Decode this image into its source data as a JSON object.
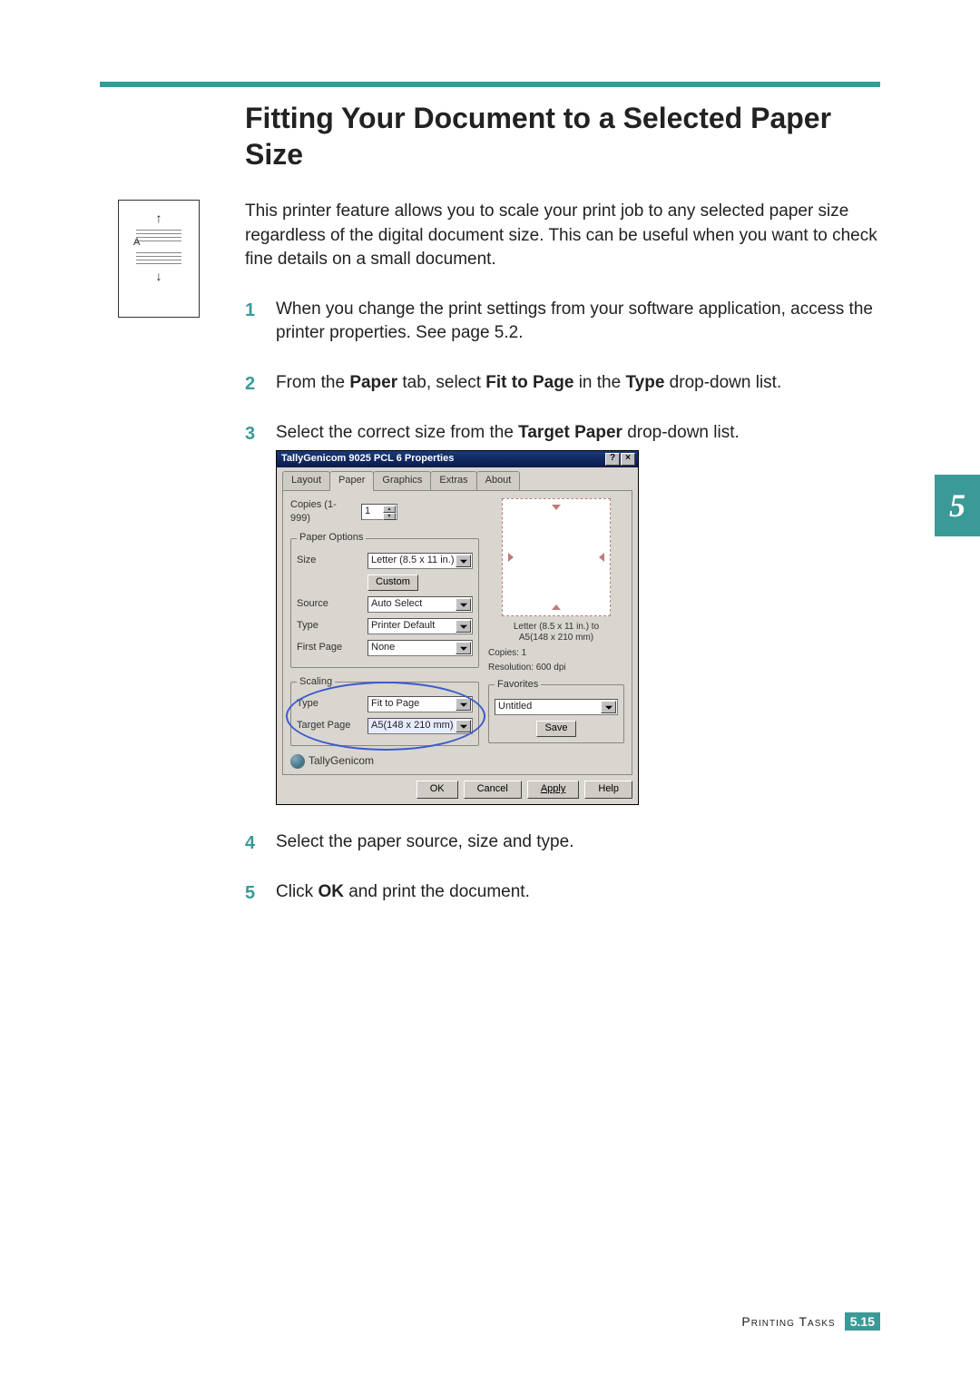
{
  "page": {
    "title": "Fitting Your Document to a Selected Paper Size",
    "intro": "This printer feature allows you to scale your print job to any selected paper size regardless of the digital document size. This can be useful when you want to check fine details on a small document.",
    "chapter_number": "5",
    "footer_label": "Printing Tasks",
    "footer_chapter": "5.",
    "footer_page": "15",
    "diagram_letter": "A"
  },
  "steps": {
    "s1": "When you change the print settings from your software application, access the printer properties. See page 5.2.",
    "s2_a": "From the ",
    "s2_b": "Paper",
    "s2_c": " tab, select ",
    "s2_d": "Fit to Page",
    "s2_e": " in the ",
    "s2_f": "Type",
    "s2_g": " drop-down list.",
    "s3_a": "Select the correct size from the ",
    "s3_b": "Target Paper",
    "s3_c": " drop-down list.",
    "s4": "Select the paper source, size and type.",
    "s5_a": "Click ",
    "s5_b": "OK",
    "s5_c": " and print the document."
  },
  "dialog": {
    "title": "TallyGenicom 9025 PCL 6 Properties",
    "help_btn": "?",
    "close_btn": "×",
    "tabs": {
      "t0": "Layout",
      "t1": "Paper",
      "t2": "Graphics",
      "t3": "Extras",
      "t4": "About"
    },
    "copies_label": "Copies (1-999)",
    "copies_value": "1",
    "paper_options_legend": "Paper Options",
    "size_label": "Size",
    "size_value": "Letter (8.5 x 11 in.)",
    "custom_btn": "Custom",
    "source_label": "Source",
    "source_value": "Auto Select",
    "type_label": "Type",
    "type_value": "Printer Default",
    "firstpage_label": "First Page",
    "firstpage_value": "None",
    "scaling_legend": "Scaling",
    "scaling_type_label": "Type",
    "scaling_type_value": "Fit to Page",
    "target_page_label": "Target Page",
    "target_page_value": "A5(148 x 210 mm)",
    "preview_line1": "Letter (8.5 x 11 in.) to",
    "preview_line2": "A5(148 x 210 mm)",
    "info_copies": "Copies: 1",
    "info_resolution": "Resolution: 600 dpi",
    "favorites_legend": "Favorites",
    "favorites_value": "Untitled",
    "save_btn": "Save",
    "brand": "TallyGenicom",
    "ok_btn": "OK",
    "cancel_btn": "Cancel",
    "apply_btn": "Apply",
    "help_footer_btn": "Help"
  }
}
